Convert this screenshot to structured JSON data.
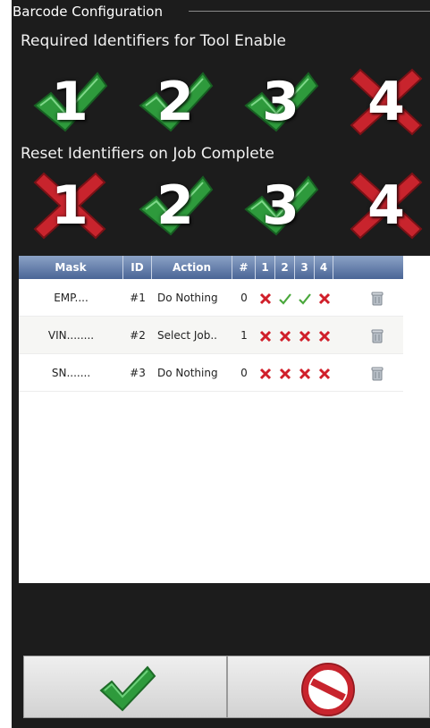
{
  "window": {
    "title": "Barcode Configuration"
  },
  "required_section": {
    "heading": "Required Identifiers for Tool Enable",
    "identifiers": [
      {
        "number": "1",
        "state": "check"
      },
      {
        "number": "2",
        "state": "check"
      },
      {
        "number": "3",
        "state": "check"
      },
      {
        "number": "4",
        "state": "cross"
      }
    ]
  },
  "reset_section": {
    "heading": "Reset Identifiers on Job Complete",
    "identifiers": [
      {
        "number": "1",
        "state": "cross"
      },
      {
        "number": "2",
        "state": "check"
      },
      {
        "number": "3",
        "state": "check"
      },
      {
        "number": "4",
        "state": "cross"
      }
    ]
  },
  "table": {
    "columns": [
      "Mask",
      "ID",
      "Action",
      "#",
      "1",
      "2",
      "3",
      "4",
      ""
    ],
    "rows": [
      {
        "mask": "EMP....",
        "id": "#1",
        "action": "Do Nothing",
        "count": "0",
        "flags": [
          "cross",
          "check",
          "check",
          "cross"
        ]
      },
      {
        "mask": "VIN........",
        "id": "#2",
        "action": "Select Job..",
        "count": "1",
        "flags": [
          "cross",
          "cross",
          "cross",
          "cross"
        ]
      },
      {
        "mask": "SN.......",
        "id": "#3",
        "action": "Do Nothing",
        "count": "0",
        "flags": [
          "cross",
          "cross",
          "cross",
          "cross"
        ]
      }
    ]
  },
  "icons": {
    "check": "check-icon",
    "cross": "cross-icon",
    "delete": "trash-icon",
    "cancel": "no-entry-icon"
  },
  "colors": {
    "check_green": "#2e9a3c",
    "cross_red": "#c8242d",
    "header_blue": "#4a6596"
  }
}
